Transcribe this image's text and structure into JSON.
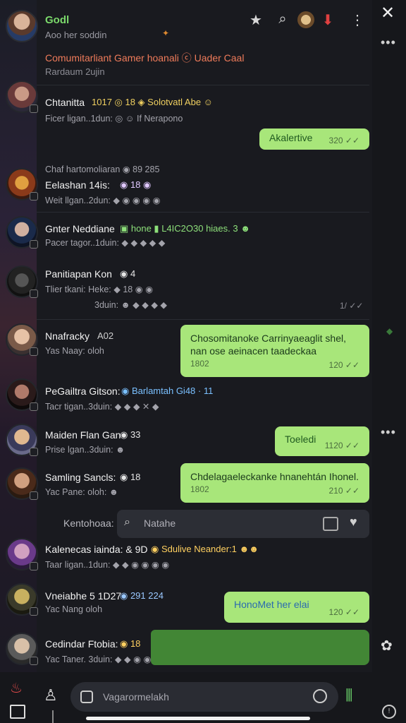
{
  "header": {
    "name": "Godl",
    "subtitle": "Aoo her soddin",
    "icons": [
      "star-icon",
      "search-icon",
      "avatar",
      "pin-icon",
      "more-icon"
    ],
    "close": "✕"
  },
  "banner": {
    "text": "Comumitarliant Gamer hoanali ⓒ Uader Caal",
    "sub": "Rardaum 2ujin"
  },
  "rows": [
    {
      "name": "Chtanitta",
      "meta": "1017 ◎ 18 ◈ Solotvatl Abe ☺",
      "sub": "Ficer ligan..1dun: ◎ ☺ If Nerapono"
    },
    {
      "sub0": "Chaf hartomoliaran ◉ 89 285",
      "name": "Eelashan 14is:",
      "meta": "◉ 18 ◉",
      "sub": "Weit llgan..2dun: ◆ ◉ ◉ ◉ ◉"
    },
    {
      "name": "Gnter Neddiane",
      "meta": "▣ hone ▮ L4IC2O30 hiaes. 3 ☻",
      "sub": "Pacer tagor..1duin: ◆ ◆ ◆ ◆ ◆"
    },
    {
      "name": "Panitiapan Kon",
      "meta": "◉ 4",
      "sub": "Tlier tkani: Heke: ◆ 18 ◉ ◉",
      "sub2": "3duin: ☻ ◆ ◆ ◆ ◆",
      "time": "1/ ✓✓"
    },
    {
      "name": "Nnafracky",
      "meta": "A02",
      "sub": "Yas Naay: oloh"
    },
    {
      "name": "PeGailtra Gitson:",
      "meta": "◉ Barlamtah Gi48 · 11",
      "sub": "Tacr tigan..3duin: ◆ ◆ ◆ ✕ ◆"
    },
    {
      "name": "Maiden Flan Gan",
      "meta": "◉ 33",
      "sub": "Prise lgan..3duin: ☻"
    },
    {
      "name": "Samling Sancls:",
      "meta": "◉ 18",
      "sub": "Yac Pane: oloh: ☻"
    },
    {
      "name": "Kalenecas iainda: & 9D",
      "meta": "◉ Sdulive Neander:1 ☻☻",
      "sub": "Taar ligan..1dun: ◆ ◆ ◉ ◉ ◉ ◉"
    },
    {
      "name": "Vneiabhe 5 1D27",
      "meta": "◉ 291 224",
      "sub": "Yac Nang oloh"
    },
    {
      "name": "Cedindar Ftobia:",
      "meta": "◉ 18",
      "sub": "Yac Taner. 3duin: ◆ ◆ ◉ ◉"
    }
  ],
  "bubbles": [
    {
      "text": "Akalertive",
      "time": "320 ✓✓"
    },
    {
      "text": "Chosomitanoke Carrinyaeaglit shel, nan ose aeinacen taadeckaa",
      "extra": "1802",
      "time": "120 ✓✓"
    },
    {
      "text": "Toeledi",
      "time": "1120 ✓✓"
    },
    {
      "text": "Chdelagaeleckanke hnanehtán Ihonel.",
      "extra": "1802",
      "time": "210 ✓✓"
    },
    {
      "text": "HonoMet her elai",
      "time": "120 ✓✓"
    }
  ],
  "search": {
    "label": "Kentohoaa:",
    "placeholder": "Natahe"
  },
  "composer": {
    "placeholder": "Vagarormelakh"
  },
  "colors": {
    "accent": "#a8e67a",
    "name_green": "#7bd96b",
    "banner": "#ef7b5a"
  }
}
